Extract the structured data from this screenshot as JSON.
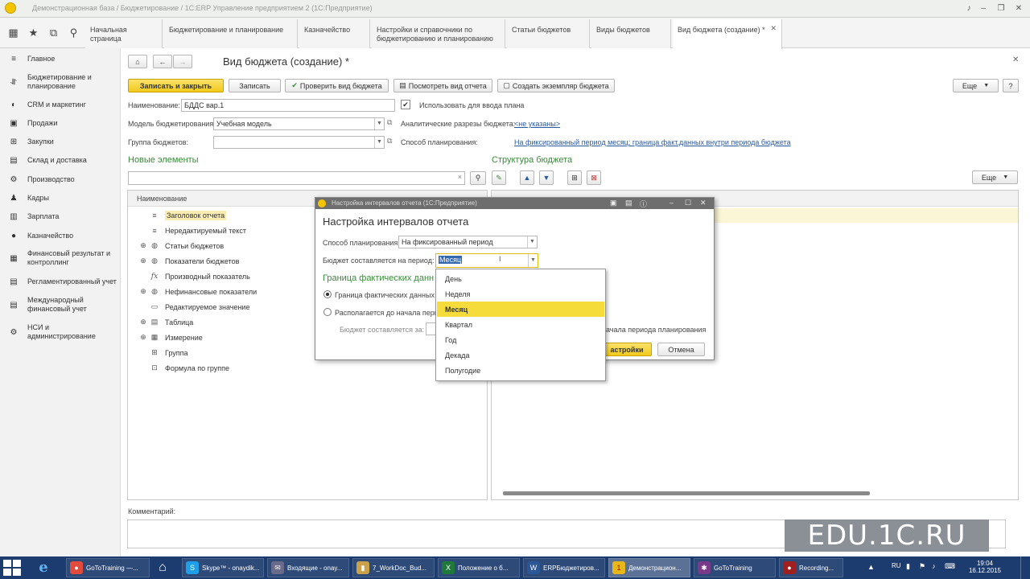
{
  "window": {
    "title": "Демонстрационная база / Бюджетирование / 1С:ERP Управление предприятием 2 (1С:Предприятие)"
  },
  "tabs": [
    {
      "label": "Начальная страница"
    },
    {
      "label": "Бюджетирование и планирование"
    },
    {
      "label": "Казначейство"
    },
    {
      "label": "Настройки и справочники по бюджетированию и планированию"
    },
    {
      "label": "Статьи бюджетов"
    },
    {
      "label": "Виды бюджетов"
    },
    {
      "label": "Вид бюджета (создание) *"
    }
  ],
  "sidebar": {
    "items": [
      {
        "label": "Главное",
        "icon": "menu-icon"
      },
      {
        "label": "Бюджетирование и планирование",
        "icon": "chart-icon"
      },
      {
        "label": "CRM и маркетинг",
        "icon": "crm-icon"
      },
      {
        "label": "Продажи",
        "icon": "bag-icon"
      },
      {
        "label": "Закупки",
        "icon": "cart-icon"
      },
      {
        "label": "Склад и доставка",
        "icon": "warehouse-icon"
      },
      {
        "label": "Производство",
        "icon": "factory-icon"
      },
      {
        "label": "Кадры",
        "icon": "person-icon"
      },
      {
        "label": "Зарплата",
        "icon": "salary-icon"
      },
      {
        "label": "Казначейство",
        "icon": "coin-icon"
      },
      {
        "label": "Финансовый результат и контроллинг",
        "icon": "finance-icon"
      },
      {
        "label": "Регламентированный учет",
        "icon": "ledger-icon"
      },
      {
        "label": "Международный финансовый учет",
        "icon": "globe-icon"
      },
      {
        "label": "НСИ и администрирование",
        "icon": "gear-icon"
      }
    ]
  },
  "form": {
    "title": "Вид бюджета (создание) *",
    "buttons": {
      "save_close": "Записать и закрыть",
      "save": "Записать",
      "check": "Проверить вид бюджета",
      "view": "Посмотреть вид отчета",
      "create_instance": "Создать экземпляр бюджета",
      "more": "Еще"
    },
    "name_label": "Наименование:",
    "name_value": "БДДС вар.1",
    "use_for_plan_label": "Использовать для ввода плана",
    "use_for_plan_checked": true,
    "model_label": "Модель бюджетирования:",
    "model_value": "Учебная модель",
    "group_label": "Группа бюджетов:",
    "group_value": "",
    "analytics_label": "Аналитические разрезы бюджета:",
    "analytics_link": "<не указаны>",
    "planning_label": "Способ планирования:",
    "planning_link": "На фиксированный период месяц;  граница факт.данных внутри периода бюджета"
  },
  "new_elements": {
    "title": "Новые элементы",
    "search_value": "",
    "column_header": "Наименование",
    "items": [
      {
        "label": "Заголовок отчета",
        "icon": "header-icon",
        "expand": false,
        "selected": true
      },
      {
        "label": "Нередактируемый текст",
        "icon": "text-icon",
        "expand": false
      },
      {
        "label": "Статьи бюджетов",
        "icon": "articles-icon",
        "expand": true
      },
      {
        "label": "Показатели бюджетов",
        "icon": "indicators-icon",
        "expand": true
      },
      {
        "label": "Производный показатель",
        "icon": "formula-icon",
        "expand": false
      },
      {
        "label": "Нефинансовые показатели",
        "icon": "nonfin-icon",
        "expand": true
      },
      {
        "label": "Редактируемое значение",
        "icon": "edit-value-icon",
        "expand": false
      },
      {
        "label": "Таблица",
        "icon": "table-icon",
        "expand": true
      },
      {
        "label": "Измерение",
        "icon": "dimension-icon",
        "expand": true
      },
      {
        "label": "Группа",
        "icon": "group-icon",
        "expand": false
      },
      {
        "label": "Формула по группе",
        "icon": "group-formula-icon",
        "expand": false
      }
    ]
  },
  "structure": {
    "title": "Структура бюджета",
    "more": "Еще"
  },
  "comment_label": "Комментарий:",
  "dialog": {
    "bar_title": "Настройка интервалов отчета (1С:Предприятие)",
    "title": "Настройка интервалов отчета",
    "planning_label": "Способ планирования:",
    "planning_value": "На фиксированный период",
    "period_label": "Бюджет составляется на период:",
    "period_value": "Месяц",
    "fact_section": "Граница фактических данн",
    "radio1": "Граница фактических данных г",
    "radio2": "Располагается до начала пери",
    "partial_text": "ачала периода планирования",
    "budget_for_label": "Бюджет составляется за:",
    "ok_button": "астройки",
    "cancel_button": "Отмена"
  },
  "period_options": [
    {
      "label": "День",
      "selected": false
    },
    {
      "label": "Неделя",
      "selected": false
    },
    {
      "label": "Месяц",
      "selected": true
    },
    {
      "label": "Квартал",
      "selected": false
    },
    {
      "label": "Год",
      "selected": false
    },
    {
      "label": "Декада",
      "selected": false
    },
    {
      "label": "Полугодие",
      "selected": false
    }
  ],
  "watermark": "EDU.1C.RU",
  "taskbar": {
    "items": [
      {
        "label": "GoToTraining —...",
        "color": "#e24a3b"
      },
      {
        "label": "Skype™ - onaydik...",
        "color": "#1ea0e8"
      },
      {
        "label": "Входящие - onay...",
        "color": "#6a6a8a"
      },
      {
        "label": "7_WorkDoc_Bud...",
        "color": "#c9a24a"
      },
      {
        "label": "Положение о б...",
        "color": "#1f7a3a"
      },
      {
        "label": "ERPБюджетиров...",
        "color": "#2b5797"
      },
      {
        "label": "Демонстрацион...",
        "color": "#e8b81a"
      },
      {
        "label": "GoToTraining",
        "color": "#7a3a8a"
      },
      {
        "label": "Recording...",
        "color": "#a02020"
      }
    ],
    "lang": "RU",
    "time": "19:04",
    "date": "16.12.2015"
  }
}
